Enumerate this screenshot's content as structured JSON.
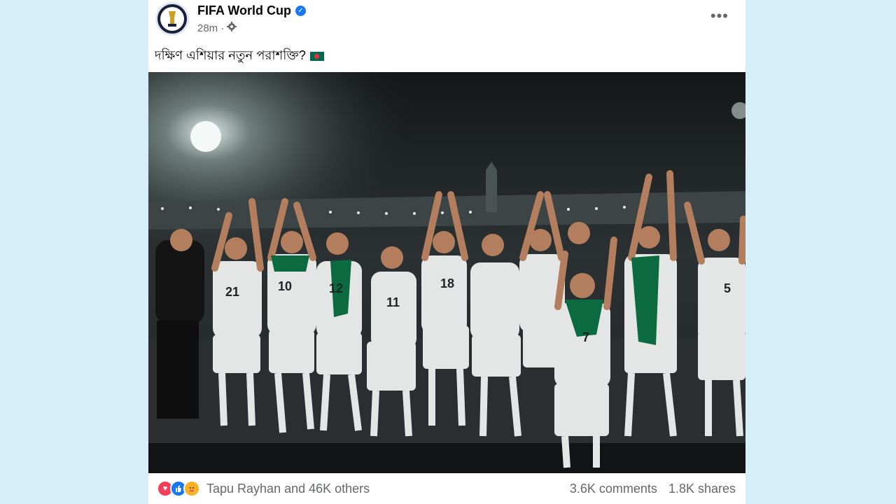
{
  "post": {
    "author": "FIFA World Cup",
    "time": "28m",
    "visibility_icon": "gear-icon",
    "caption": "দক্ষিণ এশিয়ার নতুন পরাশক্তি?",
    "caption_emoji": "bangladesh-flag",
    "more_icon": "•••"
  },
  "photo": {
    "jersey_numbers": [
      "21",
      "10",
      "12",
      "11",
      "18",
      "7",
      "5"
    ]
  },
  "engagement": {
    "reaction_icons": [
      "love-icon",
      "like-icon",
      "care-icon"
    ],
    "reactions_text": "Tapu Rayhan and 46K others",
    "comments": "3.6K comments",
    "shares": "1.8K shares"
  },
  "colors": {
    "background": "#d6eef8",
    "card": "#ffffff",
    "text": "#050505",
    "muted": "#65676b",
    "verified": "#1877f2"
  }
}
